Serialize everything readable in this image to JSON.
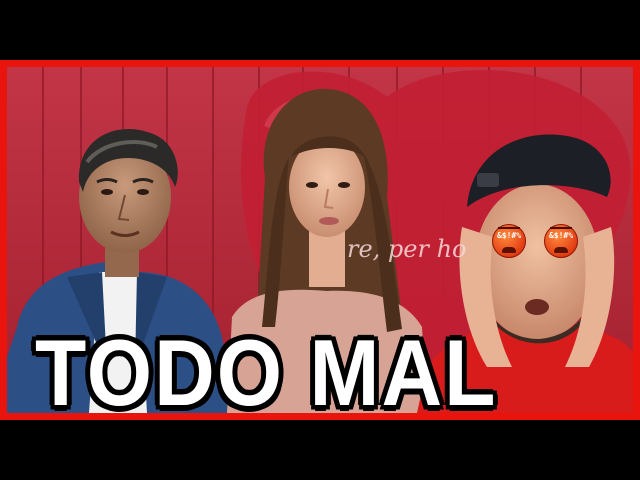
{
  "thumbnail": {
    "headline": "TODO MAL",
    "watermark": "re, per         ho",
    "emoji_label": "&$!#%",
    "colors": {
      "frame": "#e8140d",
      "wood_background": "#b82a3c",
      "heart": "#c52236",
      "headline_fill": "#ffffff",
      "headline_outline": "#000000"
    },
    "subjects": [
      "older-man",
      "young-woman",
      "man-in-cap"
    ],
    "icons": [
      "angry-face-icon",
      "angry-face-icon"
    ]
  }
}
